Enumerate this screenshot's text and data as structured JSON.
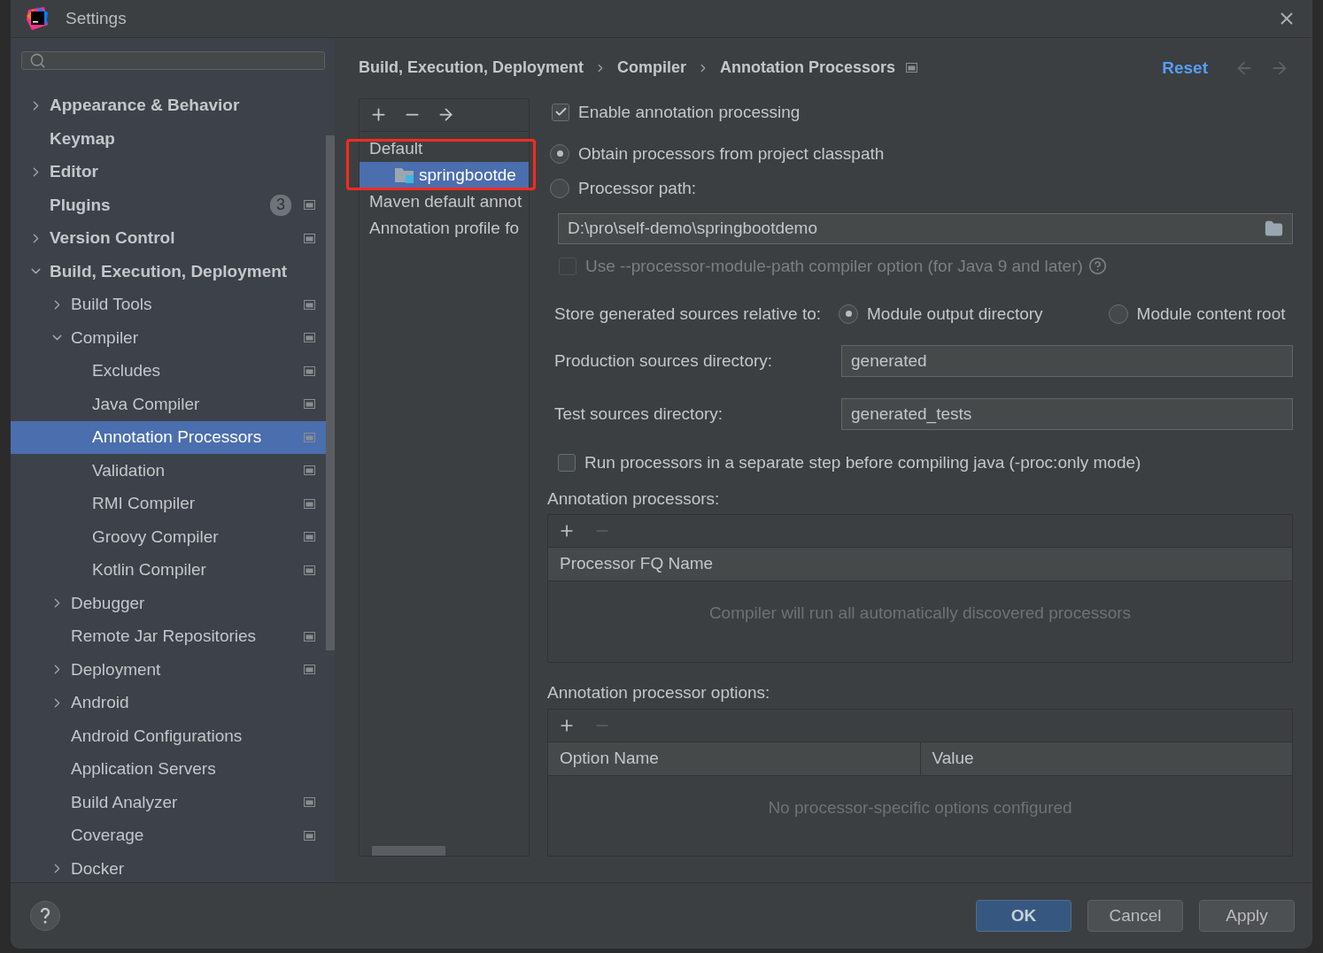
{
  "window": {
    "title": "Settings"
  },
  "sidebar": {
    "items": [
      {
        "label": "Appearance & Behavior",
        "expanded": false,
        "selected": false,
        "scoped": false
      },
      {
        "label": "Keymap",
        "selected": false,
        "scoped": false
      },
      {
        "label": "Editor",
        "expanded": false,
        "selected": false,
        "scoped": false
      },
      {
        "label": "Plugins",
        "badge": "3",
        "selected": false,
        "scoped": true
      },
      {
        "label": "Version Control",
        "expanded": false,
        "selected": false,
        "scoped": true
      },
      {
        "label": "Build, Execution, Deployment",
        "expanded": true,
        "selected": false,
        "scoped": false,
        "children": [
          {
            "label": "Build Tools",
            "expanded": false,
            "selected": false,
            "scoped": true
          },
          {
            "label": "Compiler",
            "expanded": true,
            "selected": false,
            "scoped": true,
            "children": [
              {
                "label": "Excludes",
                "selected": false,
                "scoped": true
              },
              {
                "label": "Java Compiler",
                "selected": false,
                "scoped": true
              },
              {
                "label": "Annotation Processors",
                "selected": true,
                "scoped": true
              },
              {
                "label": "Validation",
                "selected": false,
                "scoped": true
              },
              {
                "label": "RMI Compiler",
                "selected": false,
                "scoped": true
              },
              {
                "label": "Groovy Compiler",
                "selected": false,
                "scoped": true
              },
              {
                "label": "Kotlin Compiler",
                "selected": false,
                "scoped": true
              }
            ]
          },
          {
            "label": "Debugger",
            "expanded": false,
            "selected": false,
            "scoped": false
          },
          {
            "label": "Remote Jar Repositories",
            "selected": false,
            "scoped": true
          },
          {
            "label": "Deployment",
            "expanded": false,
            "selected": false,
            "scoped": true
          },
          {
            "label": "Android",
            "expanded": false,
            "selected": false,
            "scoped": false
          },
          {
            "label": "Android Configurations",
            "selected": false,
            "scoped": false
          },
          {
            "label": "Application Servers",
            "selected": false,
            "scoped": false
          },
          {
            "label": "Build Analyzer",
            "selected": false,
            "scoped": true
          },
          {
            "label": "Coverage",
            "selected": false,
            "scoped": true
          },
          {
            "label": "Docker",
            "expanded": false,
            "selected": false,
            "scoped": false
          }
        ]
      }
    ]
  },
  "breadcrumb": [
    "Build, Execution, Deployment",
    "Compiler",
    "Annotation Processors"
  ],
  "reset": "Reset",
  "profiles": {
    "items": [
      {
        "label": "Default",
        "selected": false,
        "children": [
          {
            "label": "springbootde",
            "selected": true
          }
        ]
      },
      {
        "label": "Maven default annot",
        "selected": false
      },
      {
        "label": "Annotation profile fo",
        "selected": false
      }
    ]
  },
  "enable_processing": {
    "label": "Enable annotation processing",
    "checked": true
  },
  "processor_source": [
    {
      "label": "Obtain processors from project classpath",
      "selected": true
    },
    {
      "label": "Processor path:",
      "selected": false
    }
  ],
  "processor_path": {
    "value": "D:\\pro\\self-demo\\springbootdemo"
  },
  "module_path_option": {
    "label": "Use --processor-module-path compiler option (for Java 9 and later)",
    "checked": false,
    "disabled": true
  },
  "store_relative": {
    "label": "Store generated sources relative to:",
    "options": [
      {
        "label": "Module output directory",
        "selected": true
      },
      {
        "label": "Module content root",
        "selected": false
      }
    ]
  },
  "production_dir": {
    "label": "Production sources directory:",
    "value": "generated"
  },
  "test_dir": {
    "label": "Test sources directory:",
    "value": "generated_tests"
  },
  "separate_step": {
    "label": "Run processors in a separate step before compiling java (-proc:only mode)",
    "checked": false
  },
  "processors_table": {
    "title": "Annotation processors:",
    "columns": [
      "Processor FQ Name"
    ],
    "empty_text": "Compiler will run all automatically discovered processors"
  },
  "options_table": {
    "title": "Annotation processor options:",
    "columns": [
      "Option Name",
      "Value"
    ],
    "empty_text": "No processor-specific options configured"
  },
  "buttons": [
    {
      "label": "OK",
      "kind": "primary"
    },
    {
      "label": "Cancel",
      "kind": "default"
    },
    {
      "label": "Apply",
      "kind": "default"
    }
  ]
}
